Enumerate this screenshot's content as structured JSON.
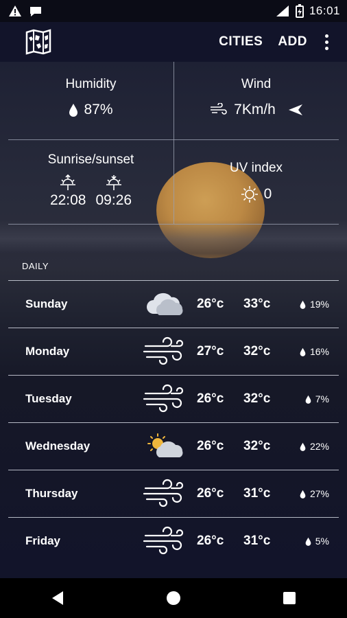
{
  "status_bar": {
    "time": "16:01",
    "network": "4G"
  },
  "app_bar": {
    "cities_label": "CITIES",
    "add_label": "ADD"
  },
  "details": {
    "humidity": {
      "title": "Humidity",
      "value": "87%"
    },
    "wind": {
      "title": "Wind",
      "value": "7Km/h"
    },
    "sun": {
      "title": "Sunrise/sunset",
      "sunrise": "22:08",
      "sunset": "09:26"
    },
    "uv": {
      "title": "UV index",
      "value": "0"
    }
  },
  "daily": {
    "label": "DAILY",
    "days": [
      {
        "day": "Sunday",
        "icon": "cloud-icon",
        "low": "26°c",
        "high": "33°c",
        "pop": "19%"
      },
      {
        "day": "Monday",
        "icon": "wind-icon",
        "low": "27°c",
        "high": "32°c",
        "pop": "16%"
      },
      {
        "day": "Tuesday",
        "icon": "wind-icon",
        "low": "26°c",
        "high": "32°c",
        "pop": "7%"
      },
      {
        "day": "Wednesday",
        "icon": "partly-cloudy-icon",
        "low": "26°c",
        "high": "32°c",
        "pop": "22%"
      },
      {
        "day": "Thursday",
        "icon": "wind-icon",
        "low": "26°c",
        "high": "31°c",
        "pop": "27%"
      },
      {
        "day": "Friday",
        "icon": "wind-icon",
        "low": "26°c",
        "high": "31°c",
        "pop": "5%"
      }
    ]
  },
  "colors": {
    "background": "#15172a",
    "moon": "#c48e45",
    "divider": "#9aa0b0"
  }
}
